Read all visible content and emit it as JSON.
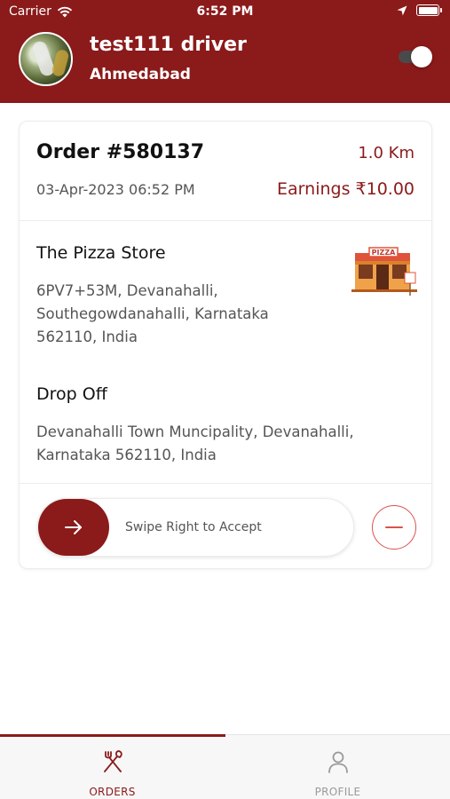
{
  "status_bar": {
    "carrier": "Carrier",
    "time": "6:52 PM"
  },
  "driver": {
    "name": "test111 driver",
    "city": "Ahmedabad",
    "online": true
  },
  "order": {
    "id_label": "Order #580137",
    "distance": "1.0 Km",
    "datetime": "03-Apr-2023 06:52 PM",
    "earnings": "Earnings ₹10.00",
    "pickup": {
      "name": "The Pizza Store",
      "address": "6PV7+53M, Devanahalli, Southegowdanahalli, Karnataka 562110, India",
      "sign_text": "PIZZA"
    },
    "dropoff": {
      "title": "Drop Off",
      "address": "Devanahalli Town Muncipality, Devanahalli, Karnataka 562110, India"
    }
  },
  "actions": {
    "swipe_label": "Swipe Right to Accept"
  },
  "tabs": [
    {
      "label": "ORDERS",
      "icon": "fork-knife-icon",
      "active": true
    },
    {
      "label": "PROFILE",
      "icon": "person-icon",
      "active": false
    }
  ],
  "colors": {
    "brand": "#8b1a1a",
    "reject": "#d9534f"
  }
}
